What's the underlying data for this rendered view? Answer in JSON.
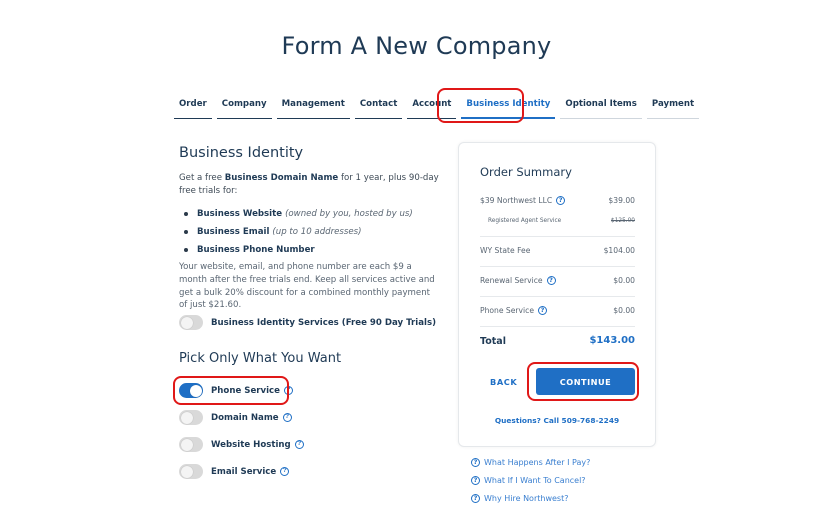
{
  "page": {
    "title": "Form A New Company"
  },
  "tabs": [
    {
      "label": "Order",
      "state": "done"
    },
    {
      "label": "Company",
      "state": "done"
    },
    {
      "label": "Management",
      "state": "done"
    },
    {
      "label": "Contact",
      "state": "done"
    },
    {
      "label": "Account",
      "state": "done"
    },
    {
      "label": "Business Identity",
      "state": "active"
    },
    {
      "label": "Optional Items",
      "state": "future"
    },
    {
      "label": "Payment",
      "state": "future"
    }
  ],
  "business_identity": {
    "title": "Business Identity",
    "intro_prefix": "Get a free ",
    "intro_bold": "Business Domain Name",
    "intro_suffix": " for 1 year, plus 90-day free trials for:",
    "features": [
      {
        "name": "Business Website",
        "note": "(owned by you, hosted by us)"
      },
      {
        "name": "Business Email",
        "note": "(up to 10 addresses)"
      },
      {
        "name": "Business Phone Number",
        "note": ""
      }
    ],
    "description": "Your website, email, and phone number are each $9 a month after the free trials end. Keep all services active and get a bulk 20% discount for a combined monthly payment of just $21.60.",
    "master_toggle": {
      "label": "Business Identity Services (Free 90 Day Trials)",
      "on": false
    }
  },
  "pick": {
    "title": "Pick Only What You Want",
    "options": [
      {
        "label": "Phone Service",
        "on": true
      },
      {
        "label": "Domain Name",
        "on": false
      },
      {
        "label": "Website Hosting",
        "on": false
      },
      {
        "label": "Email Service",
        "on": false
      }
    ]
  },
  "summary": {
    "title": "Order Summary",
    "items": [
      {
        "label": "$39 Northwest LLC",
        "amount": "$39.00"
      },
      {
        "label": "Registered Agent Service",
        "amount": "$125.00"
      },
      {
        "label": "WY State Fee",
        "amount": "$104.00"
      },
      {
        "label": "Renewal Service",
        "amount": "$0.00"
      },
      {
        "label": "Phone Service",
        "amount": "$0.00"
      }
    ],
    "total_label": "Total",
    "total_amount": "$143.00",
    "back_label": "BACK",
    "continue_label": "CONTINUE",
    "questions_label": "Questions? Call 509-768-2249"
  },
  "faq": [
    "What Happens After I Pay?",
    "What If I Want To Cancel?",
    "Why Hire Northwest?"
  ],
  "colors": {
    "accent": "#1f6fc5",
    "heading": "#1f3a55",
    "highlight": "#e01818"
  }
}
